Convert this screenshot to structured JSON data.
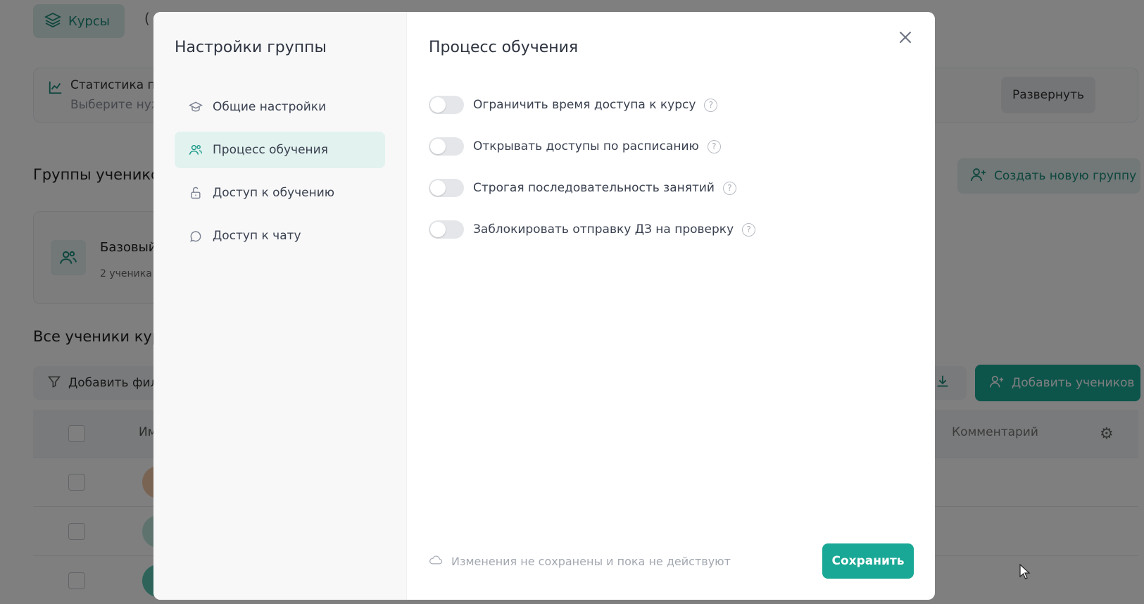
{
  "background": {
    "tab_courses_label": "Курсы",
    "stat_title": "Статистика по",
    "stat_subtitle": "Выберите нуж",
    "expand_label": "Развернуть",
    "groups_title": "Группы ученико",
    "create_group_label": "Создать новую группу",
    "group_name": "Базовый",
    "group_count": "2 ученика",
    "all_students_title": "Все ученики кур",
    "filter_label": "Добавить фил",
    "add_students_label": "Добавить учеников",
    "col_name": "Им",
    "col_comment": "Комментарий"
  },
  "modal": {
    "title": "Настройки группы",
    "nav": [
      {
        "label": "Общие настройки",
        "icon": "graduation-cap-icon"
      },
      {
        "label": "Процесс обучения",
        "icon": "users-icon"
      },
      {
        "label": "Доступ к обучению",
        "icon": "lock-open-icon"
      },
      {
        "label": "Доступ к чату",
        "icon": "chat-icon"
      }
    ],
    "section_title": "Процесс обучения",
    "settings": [
      {
        "label": "Ограничить время доступа к курсу",
        "enabled": false
      },
      {
        "label": "Открывать доступы по расписанию",
        "enabled": false
      },
      {
        "label": "Строгая последовательность занятий",
        "enabled": false
      },
      {
        "label": "Заблокировать отправку ДЗ на проверку",
        "enabled": false
      }
    ],
    "unsaved_note": "Изменения не сохранены и пока не действуют",
    "save_label": "Сохранить"
  },
  "colors": {
    "accent": "#1aa896",
    "active_nav_bg": "#e2f2ef",
    "toggle_off": "#e4e6e9"
  }
}
